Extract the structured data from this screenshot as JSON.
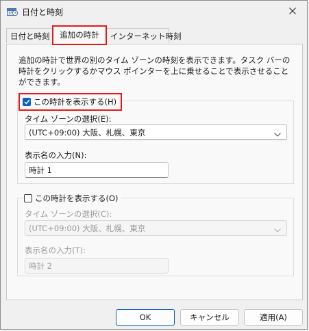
{
  "window": {
    "title": "日付と時刻"
  },
  "tabs": [
    {
      "label": "日付と時刻"
    },
    {
      "label": "追加の時計"
    },
    {
      "label": "インターネット時刻"
    }
  ],
  "main": {
    "description": "追加の時計で世界の別のタイム ゾーンの時刻を表示できます。タスク バーの時計をクリックするかマウス ポインターを上に乗せることで表示させることができます。",
    "clock1": {
      "show_label": "この時計を表示する(H)",
      "checked": true,
      "timezone_label": "タイム ゾーンの選択(E):",
      "timezone_value": "(UTC+09:00) 大阪、札幌、東京",
      "name_label": "表示名の入力(N):",
      "name_value": "時計 1"
    },
    "clock2": {
      "show_label": "この時計を表示する(O)",
      "checked": false,
      "timezone_label": "タイム ゾーンの選択(C):",
      "timezone_value": "(UTC+09:00) 大阪、札幌、東京",
      "name_label": "表示名の入力(T):",
      "name_value": "時計 2"
    }
  },
  "buttons": {
    "ok": "OK",
    "cancel": "キャンセル",
    "apply": "適用(A)"
  },
  "colors": {
    "accent": "#0a5fc0",
    "highlight": "#e21a1a"
  },
  "icons": {
    "app": "date-time-icon",
    "close": "close-icon",
    "chevron": "chevron-down-icon",
    "check": "check-icon"
  }
}
